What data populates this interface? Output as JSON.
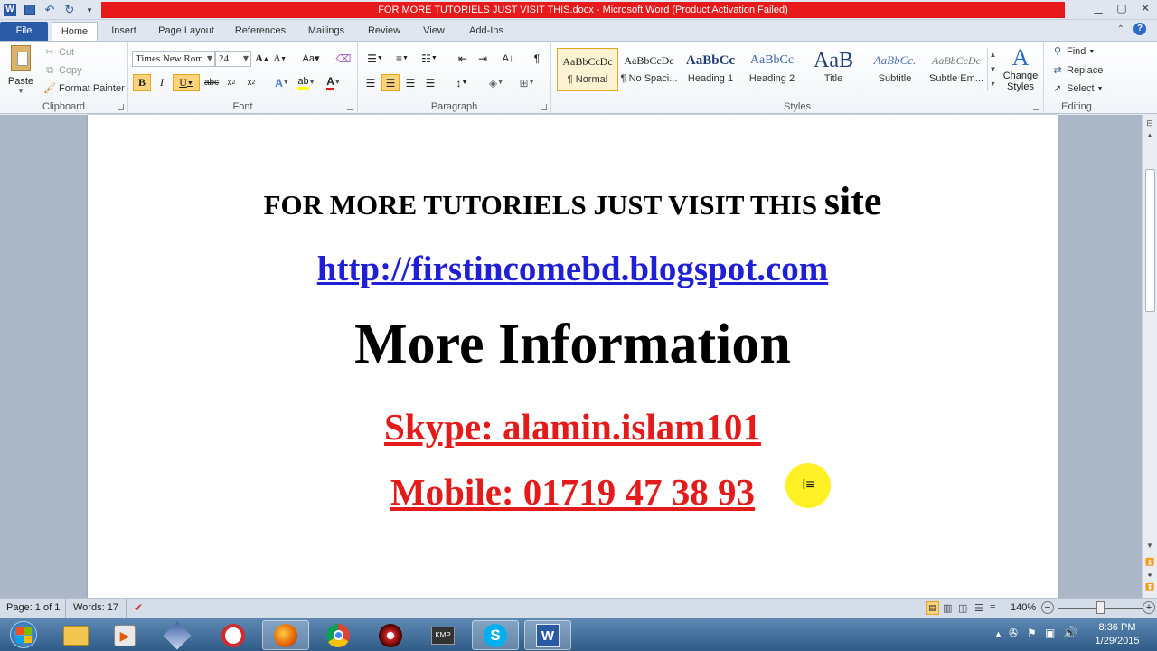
{
  "window": {
    "title": "FOR MORE TUTORIELS JUST VISIT THIS.docx - Microsoft Word (Product Activation Failed)"
  },
  "ribbon_tabs": [
    "File",
    "Home",
    "Insert",
    "Page Layout",
    "References",
    "Mailings",
    "Review",
    "View",
    "Add-Ins"
  ],
  "clipboard": {
    "paste": "Paste",
    "cut": "Cut",
    "copy": "Copy",
    "format_painter": "Format Painter",
    "label": "Clipboard"
  },
  "font": {
    "name": "Times New Rom",
    "size": "24",
    "label": "Font"
  },
  "paragraph": {
    "label": "Paragraph"
  },
  "styles": {
    "label": "Styles",
    "items": [
      {
        "preview": "AaBbCcDc",
        "name": "¶ Normal"
      },
      {
        "preview": "AaBbCcDc",
        "name": "¶ No Spaci..."
      },
      {
        "preview": "AaBbCc",
        "name": "Heading 1"
      },
      {
        "preview": "AaBbCc",
        "name": "Heading 2"
      },
      {
        "preview": "AaB",
        "name": "Title"
      },
      {
        "preview": "AaBbCc.",
        "name": "Subtitle"
      },
      {
        "preview": "AaBbCcDc",
        "name": "Subtle Em..."
      }
    ],
    "change_styles": [
      "Change",
      "Styles"
    ]
  },
  "editing": {
    "find": "Find",
    "replace": "Replace",
    "select": "Select",
    "label": "Editing"
  },
  "document": {
    "line1_main": "FOR MORE TUTORIELS JUST VISIT THIS",
    "line1_end": "site",
    "link": "http://firstincomebd.blogspot.com",
    "heading": "More Information",
    "skype": "Skype: alamin.islam101",
    "mobile": "Mobile: 01719 47 38 93"
  },
  "statusbar": {
    "page": "Page: 1 of 1",
    "words": "Words: 17",
    "zoom": "140%"
  },
  "taskbar": {
    "time": "8:36 PM",
    "date": "1/29/2015"
  },
  "colors": {
    "title_red": "#e8191a",
    "link_blue": "#1f1fd6",
    "doc_red": "#e31b1b",
    "file_tab": "#2a5aa6"
  }
}
